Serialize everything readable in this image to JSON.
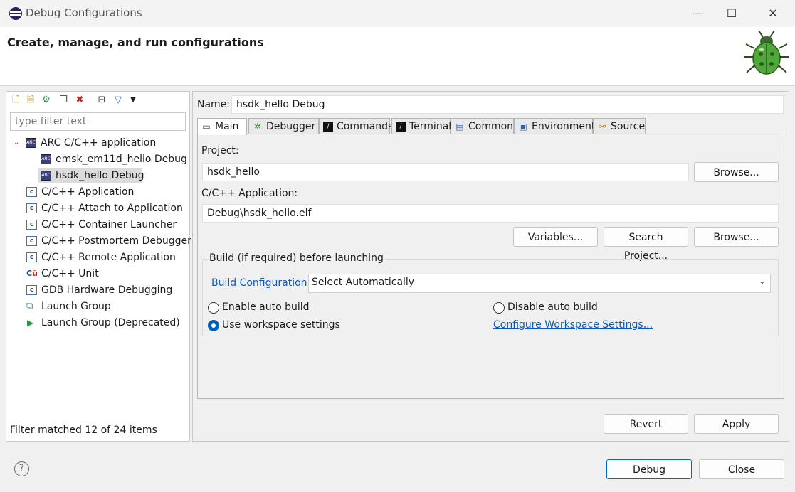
{
  "window": {
    "title": "Debug Configurations",
    "minimize_glyph": "—",
    "maximize_glyph": "☐",
    "close_glyph": "✕"
  },
  "banner": {
    "title": "Create, manage, and run configurations"
  },
  "left": {
    "filter_placeholder": "type filter text",
    "tree": {
      "group": "ARC C/C++ application",
      "group_children": [
        "emsk_em11d_hello Debug",
        "hsdk_hello Debug"
      ],
      "selected": "hsdk_hello Debug",
      "items": [
        "C/C++ Application",
        "C/C++ Attach to Application",
        "C/C++ Container Launcher",
        "C/C++ Postmortem Debugger",
        "C/C++ Remote Application",
        "C/C++ Unit",
        "GDB Hardware Debugging",
        "Launch Group",
        "Launch Group (Deprecated)"
      ]
    },
    "status": "Filter matched 12 of 24 items"
  },
  "right": {
    "name_label": "Name:",
    "name_value": "hsdk_hello Debug",
    "tabs": [
      "Main",
      "Debugger",
      "Commands",
      "Terminal",
      "Common",
      "Environment",
      "Source"
    ],
    "active_tab": "Main",
    "main": {
      "project_label": "Project:",
      "project_value": "hsdk_hello",
      "browse_label": "Browse...",
      "app_label": "C/C++ Application:",
      "app_value": "Debug\\hsdk_hello.elf",
      "variables_label": "Variables...",
      "search_project_label": "Search Project...",
      "browse2_label": "Browse...",
      "build_group_label": "Build (if required) before launching",
      "build_config_link": "Build Configuration:",
      "build_config_value": "Select Automatically",
      "enable_auto_build": "Enable auto build",
      "disable_auto_build": "Disable auto build",
      "use_workspace_settings": "Use workspace settings",
      "configure_workspace_link": "Configure Workspace Settings...",
      "selected_radio": "Use workspace settings"
    },
    "revert_label": "Revert",
    "apply_label": "Apply"
  },
  "footer": {
    "help_glyph": "?",
    "debug_label": "Debug",
    "close_label": "Close"
  }
}
